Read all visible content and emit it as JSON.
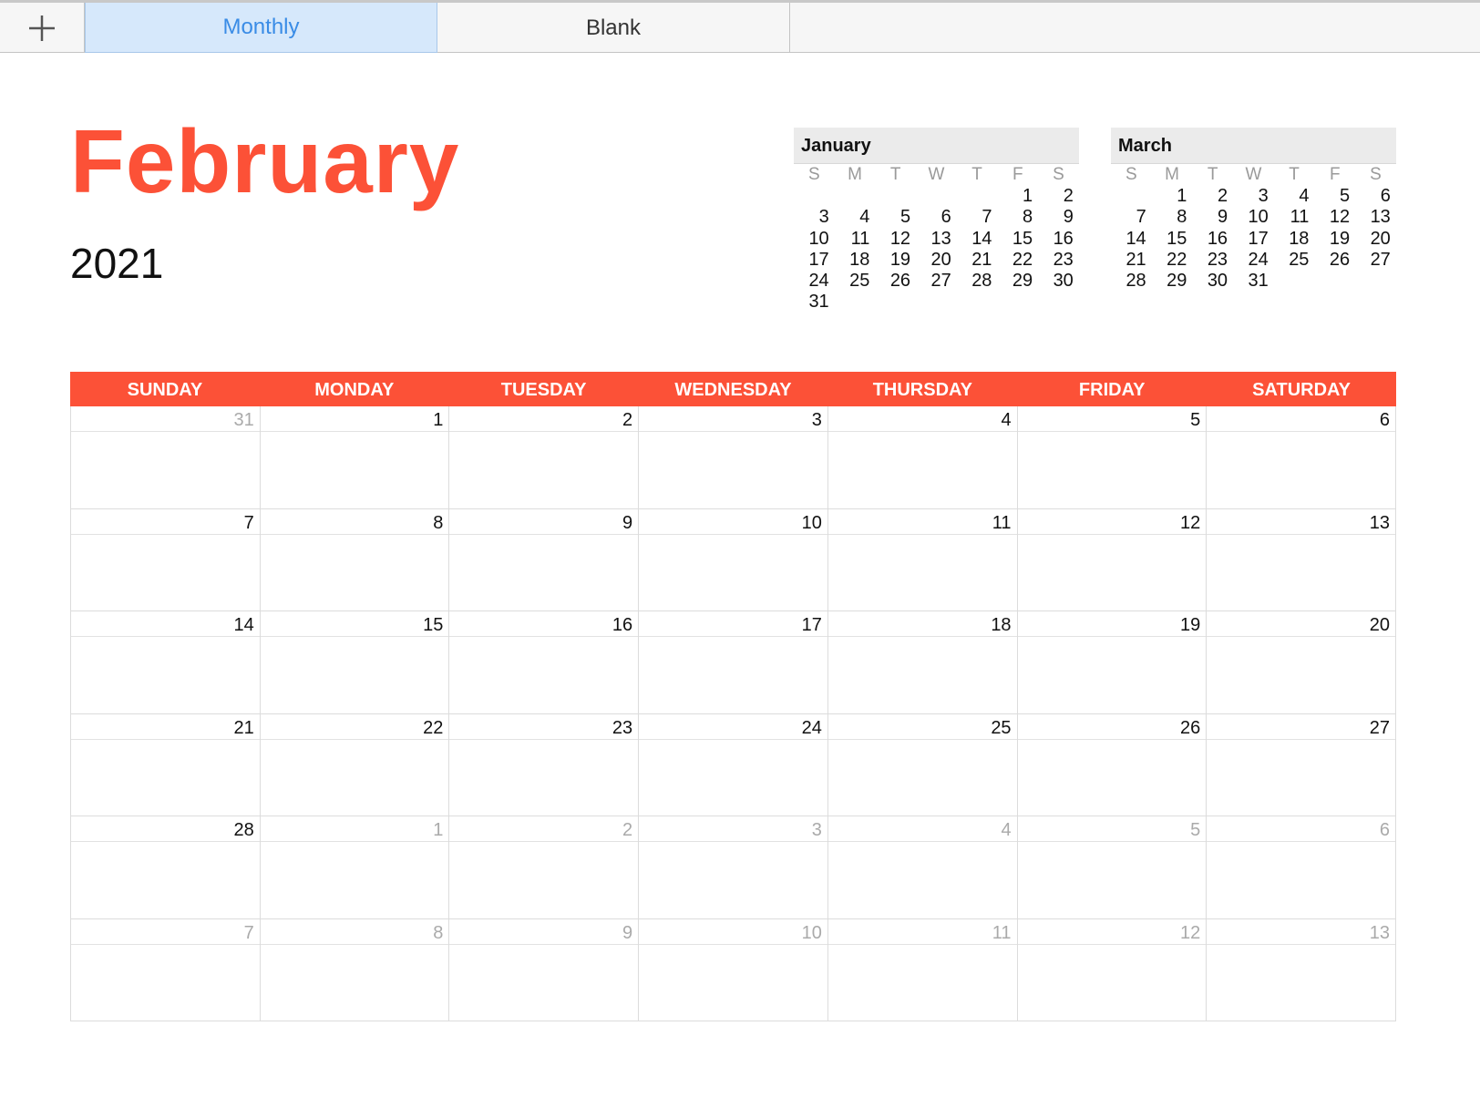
{
  "tabs": {
    "add_icon": "plus-icon",
    "items": [
      {
        "label": "Monthly",
        "active": true
      },
      {
        "label": "Blank",
        "active": false
      }
    ]
  },
  "calendar": {
    "month": "February",
    "year": "2021",
    "accent_color": "#fc5137"
  },
  "mini_calendars": [
    {
      "name": "January",
      "dow": [
        "S",
        "M",
        "T",
        "W",
        "T",
        "F",
        "S"
      ],
      "days": [
        "",
        "",
        "",
        "",
        "",
        "1",
        "2",
        "3",
        "4",
        "5",
        "6",
        "7",
        "8",
        "9",
        "10",
        "11",
        "12",
        "13",
        "14",
        "15",
        "16",
        "17",
        "18",
        "19",
        "20",
        "21",
        "22",
        "23",
        "24",
        "25",
        "26",
        "27",
        "28",
        "29",
        "30",
        "31"
      ]
    },
    {
      "name": "March",
      "dow": [
        "S",
        "M",
        "T",
        "W",
        "T",
        "F",
        "S"
      ],
      "days": [
        "",
        "1",
        "2",
        "3",
        "4",
        "5",
        "6",
        "7",
        "8",
        "9",
        "10",
        "11",
        "12",
        "13",
        "14",
        "15",
        "16",
        "17",
        "18",
        "19",
        "20",
        "21",
        "22",
        "23",
        "24",
        "25",
        "26",
        "27",
        "28",
        "29",
        "30",
        "31"
      ]
    }
  ],
  "weekdays": [
    "SUNDAY",
    "MONDAY",
    "TUESDAY",
    "WEDNESDAY",
    "THURSDAY",
    "FRIDAY",
    "SATURDAY"
  ],
  "main_days": [
    {
      "d": "31",
      "cur": false
    },
    {
      "d": "1",
      "cur": true
    },
    {
      "d": "2",
      "cur": true
    },
    {
      "d": "3",
      "cur": true
    },
    {
      "d": "4",
      "cur": true
    },
    {
      "d": "5",
      "cur": true
    },
    {
      "d": "6",
      "cur": true
    },
    {
      "d": "7",
      "cur": true
    },
    {
      "d": "8",
      "cur": true
    },
    {
      "d": "9",
      "cur": true
    },
    {
      "d": "10",
      "cur": true
    },
    {
      "d": "11",
      "cur": true
    },
    {
      "d": "12",
      "cur": true
    },
    {
      "d": "13",
      "cur": true
    },
    {
      "d": "14",
      "cur": true
    },
    {
      "d": "15",
      "cur": true
    },
    {
      "d": "16",
      "cur": true
    },
    {
      "d": "17",
      "cur": true
    },
    {
      "d": "18",
      "cur": true
    },
    {
      "d": "19",
      "cur": true
    },
    {
      "d": "20",
      "cur": true
    },
    {
      "d": "21",
      "cur": true
    },
    {
      "d": "22",
      "cur": true
    },
    {
      "d": "23",
      "cur": true
    },
    {
      "d": "24",
      "cur": true
    },
    {
      "d": "25",
      "cur": true
    },
    {
      "d": "26",
      "cur": true
    },
    {
      "d": "27",
      "cur": true
    },
    {
      "d": "28",
      "cur": true
    },
    {
      "d": "1",
      "cur": false
    },
    {
      "d": "2",
      "cur": false
    },
    {
      "d": "3",
      "cur": false
    },
    {
      "d": "4",
      "cur": false
    },
    {
      "d": "5",
      "cur": false
    },
    {
      "d": "6",
      "cur": false
    },
    {
      "d": "7",
      "cur": false
    },
    {
      "d": "8",
      "cur": false
    },
    {
      "d": "9",
      "cur": false
    },
    {
      "d": "10",
      "cur": false
    },
    {
      "d": "11",
      "cur": false
    },
    {
      "d": "12",
      "cur": false
    },
    {
      "d": "13",
      "cur": false
    }
  ]
}
